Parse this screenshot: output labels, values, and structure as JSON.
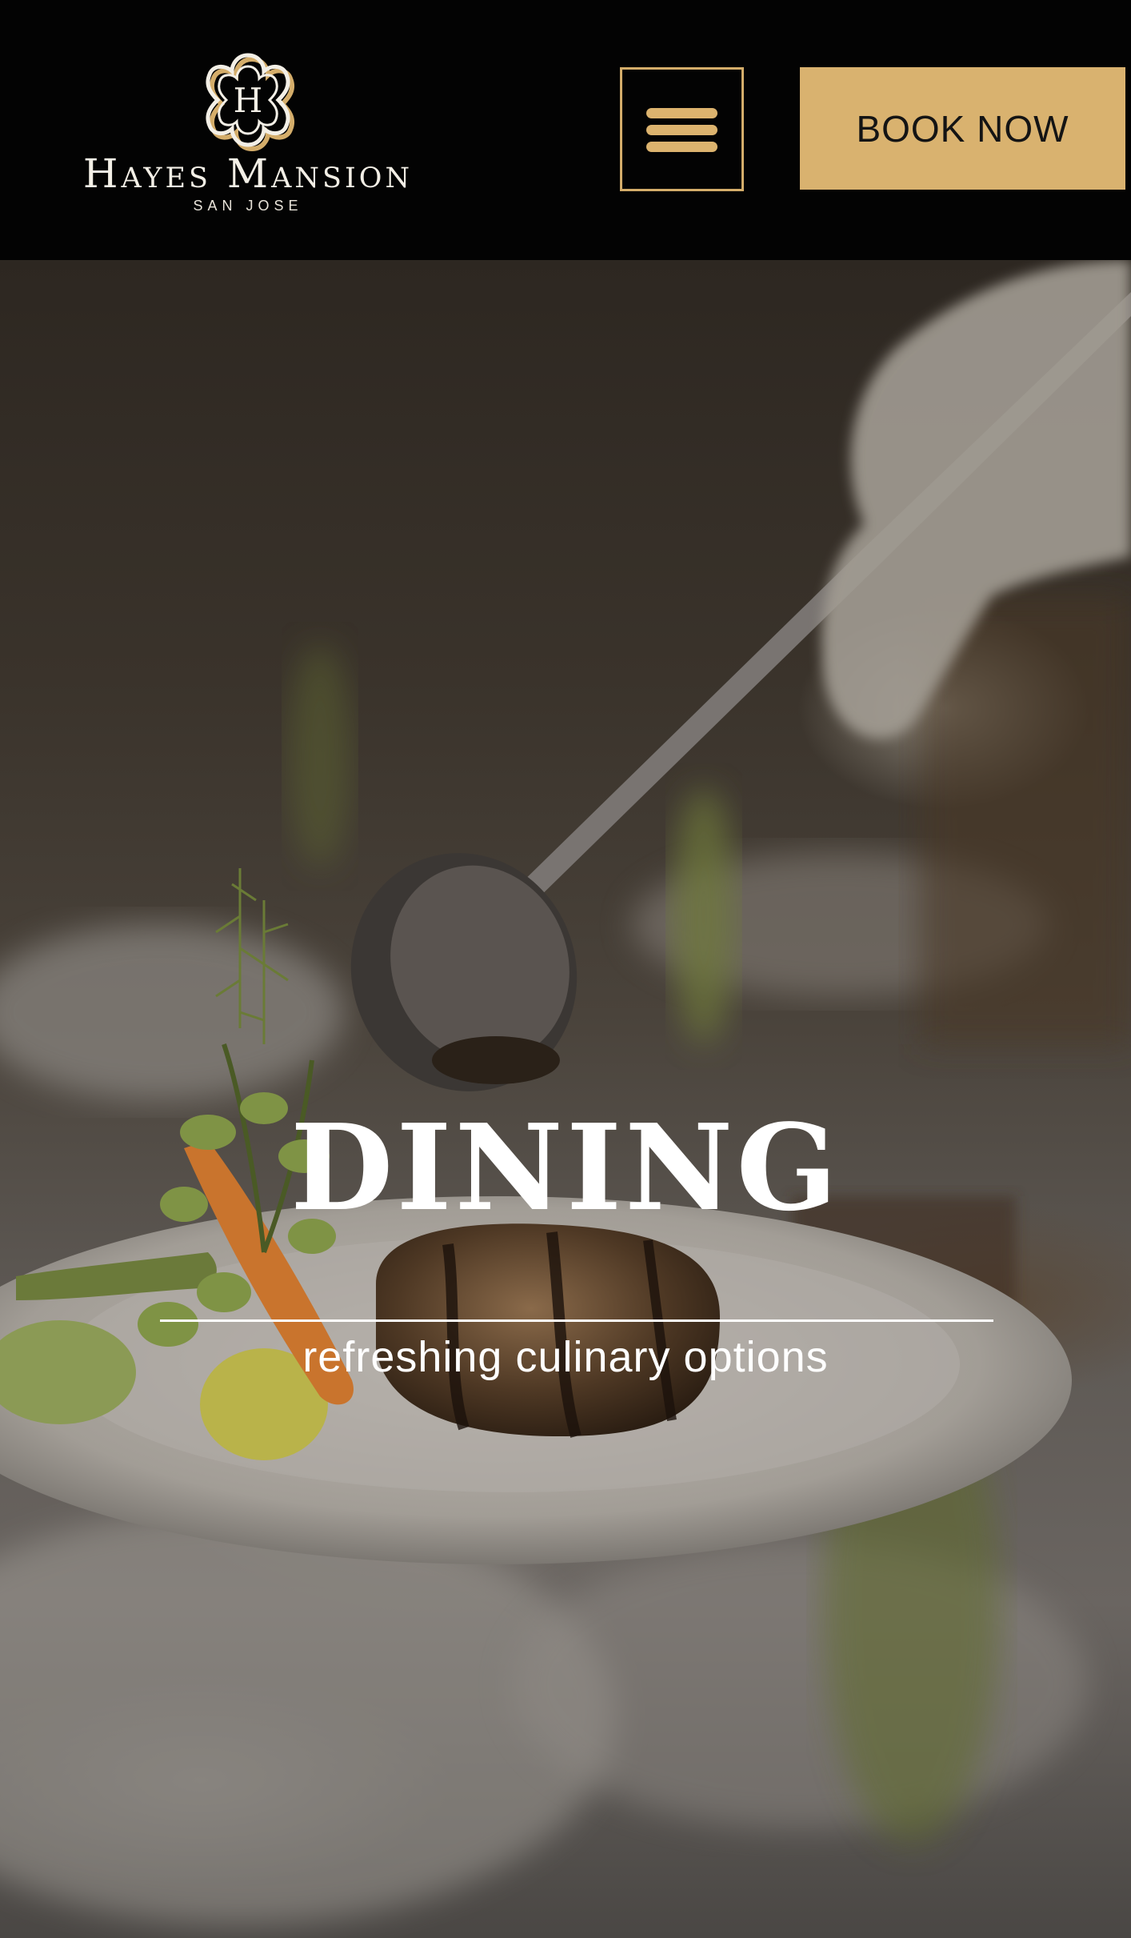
{
  "header": {
    "logo": {
      "monogram": "H",
      "name": "Hayes Mansion",
      "location": "SAN JOSE",
      "accent_color": "#d4ad6a"
    },
    "menu_icon": "hamburger-menu-icon",
    "book_button_label": "BOOK NOW",
    "book_button_color": "#d9b26f"
  },
  "hero": {
    "title": "DINING",
    "subtitle": "refreshing culinary options"
  }
}
